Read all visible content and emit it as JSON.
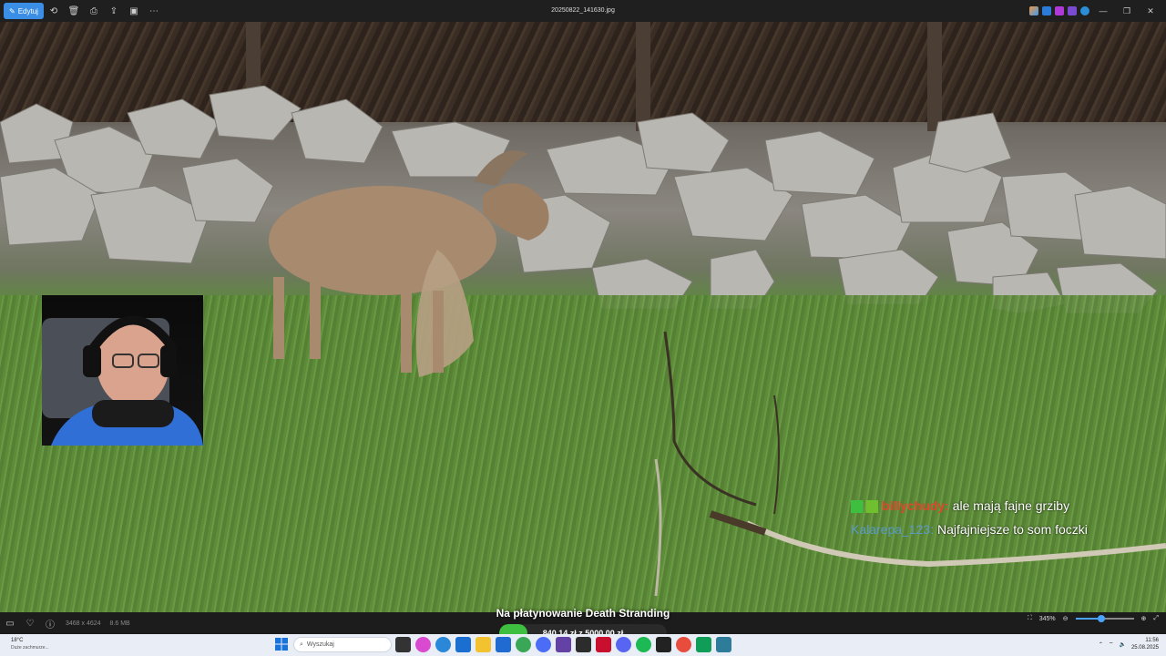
{
  "titlebar": {
    "edit_label": "Edytuj",
    "filename": "20250822_141630.jpg"
  },
  "statusbar": {
    "dimensions": "3468 x 4624",
    "filesize": "8.6 MB",
    "zoom": "345%",
    "zoom_fraction": 0.45
  },
  "chat": [
    {
      "user": "billychudy",
      "message": "ale mają fajne grziby"
    },
    {
      "user": "Kalarepa_123",
      "message": "Najfajniejsze to som foczki"
    }
  ],
  "donation": {
    "title": "Na płatynowanie Death Stranding",
    "progress_text": "840,14 zł z 5000,00 zł",
    "progress_fraction": 0.168
  },
  "taskbar": {
    "weather_temp": "18°C",
    "weather_cond": "Duże zachmurze...",
    "search_placeholder": "Wyszukaj",
    "time": "11:56",
    "date": "25.08.2025"
  },
  "colors": {
    "accent": "#3a8ee6",
    "chat_user1": "#e0462c",
    "chat_user2": "#5a9ac8",
    "donate_fill": "#3fbf3f"
  }
}
